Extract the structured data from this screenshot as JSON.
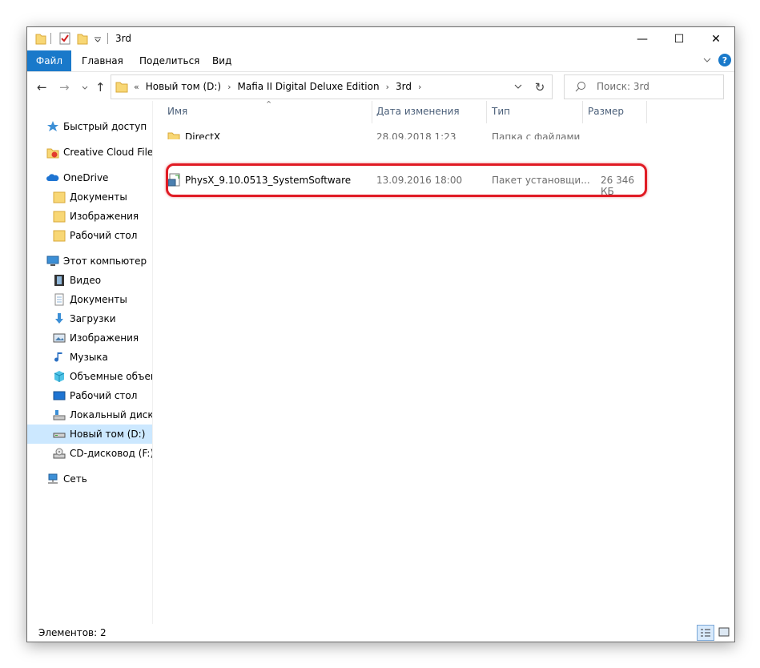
{
  "window": {
    "title": "3rd",
    "controls": {
      "minimize": "—",
      "maximize": "☐",
      "close": "✕"
    }
  },
  "ribbon": {
    "tabs": [
      "Файл",
      "Главная",
      "Поделиться",
      "Вид"
    ],
    "help": "?"
  },
  "nav": {
    "breadcrumb_overflow": "«",
    "breadcrumb": [
      "Новый том (D:)",
      "Mafia II Digital Deluxe Edition",
      "3rd"
    ],
    "search_placeholder": "Поиск: 3rd"
  },
  "sidebar": {
    "items": [
      {
        "label": "Быстрый доступ",
        "icon": "star-icon"
      },
      {
        "label": "Creative Cloud Files",
        "icon": "creative-cloud-icon"
      },
      {
        "label": "OneDrive",
        "icon": "cloud-icon"
      },
      {
        "label": "Документы",
        "icon": "folder-icon"
      },
      {
        "label": "Изображения",
        "icon": "folder-icon"
      },
      {
        "label": "Рабочий стол",
        "icon": "folder-icon"
      },
      {
        "label": "Этот компьютер",
        "icon": "computer-icon"
      },
      {
        "label": "Видео",
        "icon": "video-icon"
      },
      {
        "label": "Документы",
        "icon": "document-icon"
      },
      {
        "label": "Загрузки",
        "icon": "download-icon"
      },
      {
        "label": "Изображения",
        "icon": "pictures-icon"
      },
      {
        "label": "Музыка",
        "icon": "music-icon"
      },
      {
        "label": "Объемные объект",
        "icon": "3d-objects-icon"
      },
      {
        "label": "Рабочий стол",
        "icon": "desktop-icon"
      },
      {
        "label": "Локальный диск (C",
        "icon": "local-disk-icon"
      },
      {
        "label": "Новый том (D:)",
        "icon": "drive-icon",
        "selected": true
      },
      {
        "label": "CD-дисковод (F:)",
        "icon": "cd-drive-icon"
      },
      {
        "label": "Сеть",
        "icon": "network-icon"
      }
    ]
  },
  "columns": [
    "Имя",
    "Дата изменения",
    "Тип",
    "Размер"
  ],
  "files": [
    {
      "name": "DirectX",
      "date": "28.09.2018 1:23",
      "type": "Папка с файлами",
      "size": "",
      "icon": "folder-icon"
    },
    {
      "name": "PhysX_9.10.0513_SystemSoftware",
      "date": "13.09.2016 18:00",
      "type": "Пакет установщи...",
      "size": "26 346 КБ",
      "icon": "installer-icon",
      "highlighted": true
    }
  ],
  "status": {
    "items_count": "Элементов: 2"
  },
  "colors": {
    "accent": "#1979ca",
    "selection": "#cce8ff",
    "highlight": "#e01b24",
    "folder": "#f8d775"
  }
}
